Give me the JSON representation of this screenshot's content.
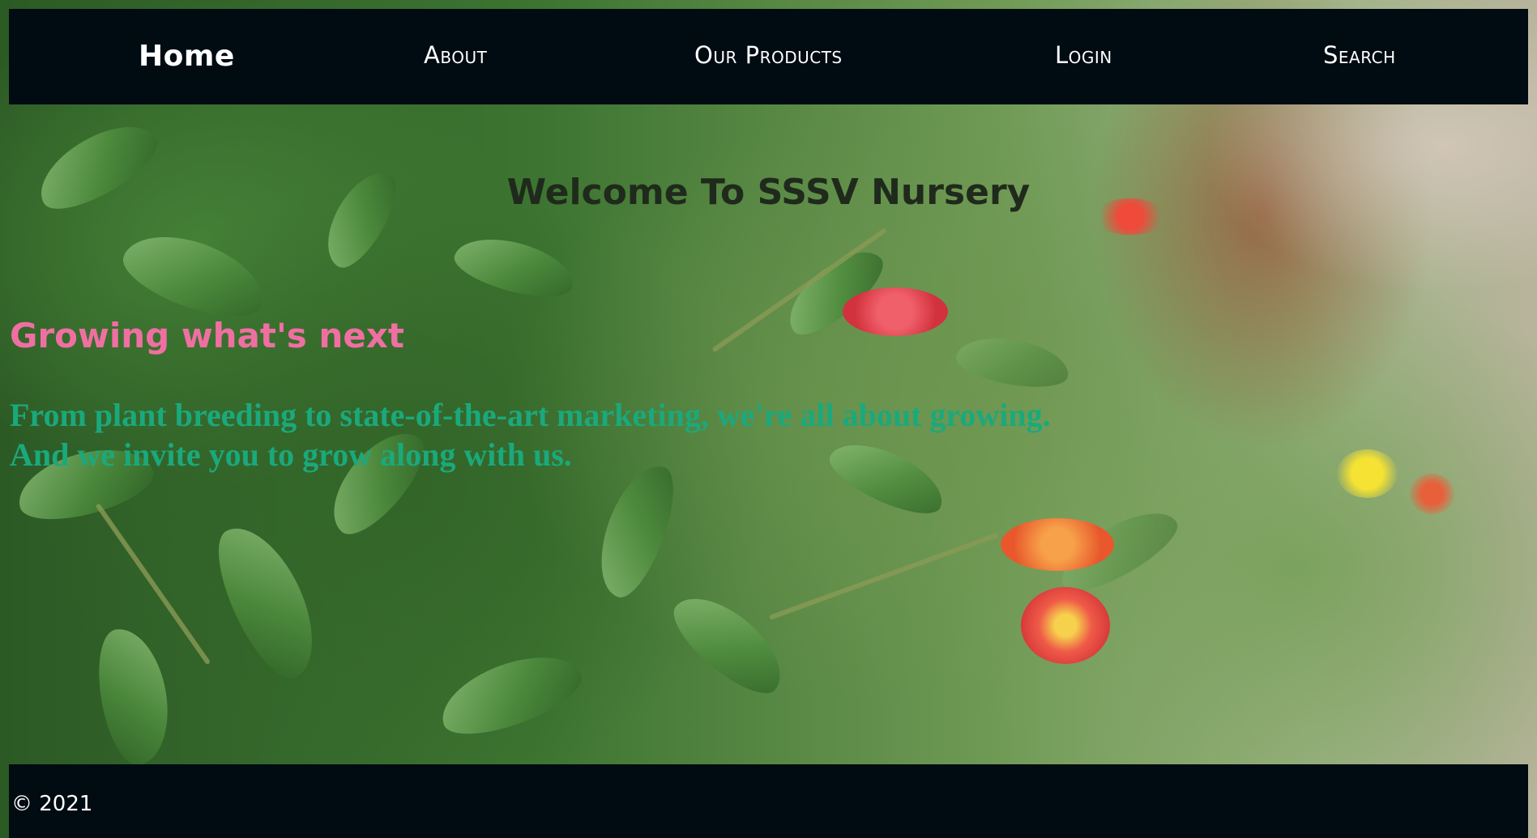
{
  "nav": {
    "home": "Home",
    "about": "About",
    "products": "Our Products",
    "login": "Login",
    "search": "Search"
  },
  "hero": {
    "welcome": "Welcome To SSSV Nursery",
    "tagline": "Growing what's next",
    "intro_line1": "From plant breeding to state-of-the-art marketing, we're all about growing.",
    "intro_line2": "And we invite you to grow along with us."
  },
  "footer": {
    "copyright": "© 2021"
  },
  "colors": {
    "nav_bg": "#010b12",
    "tagline": "#f06fa3",
    "intro": "#1aa97c",
    "welcome": "#1f2a1c"
  }
}
